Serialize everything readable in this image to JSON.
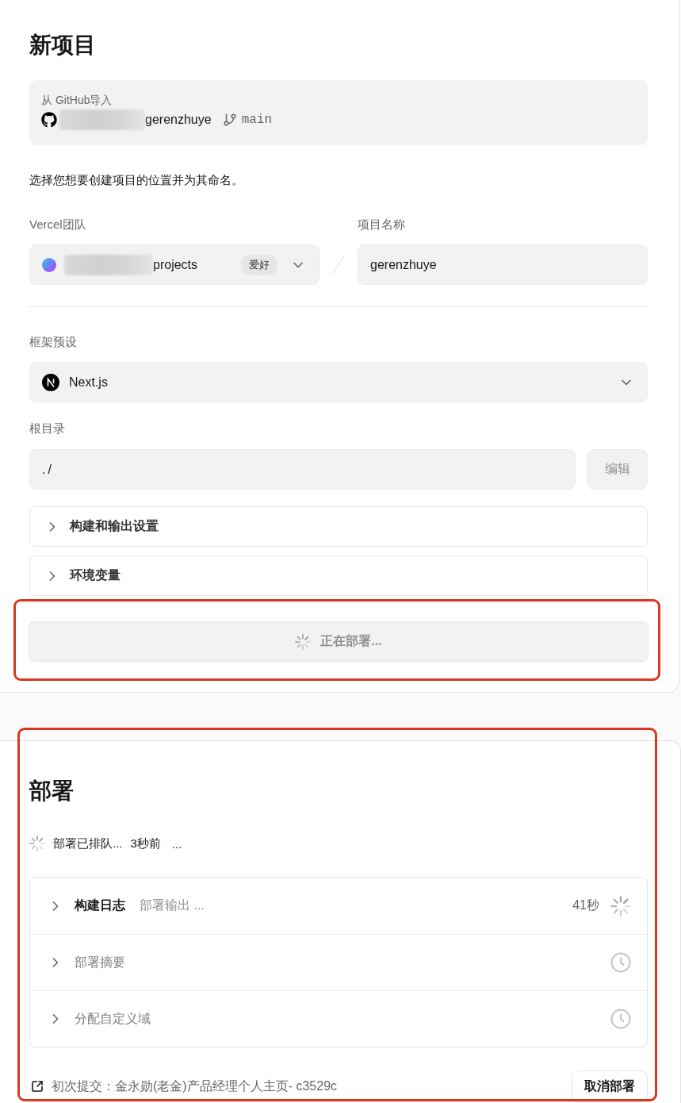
{
  "new_project": {
    "title": "新项目",
    "import_box": {
      "label": "从 GitHub导入",
      "repo": "gerenzhuye",
      "branch": "main"
    },
    "description": "选择您想要创建项目的位置并为其命名。",
    "team": {
      "label": "Vercel团队",
      "value": "projects",
      "badge": "爱好"
    },
    "project_name": {
      "label": "项目名称",
      "value": "gerenzhuye"
    },
    "framework": {
      "label": "框架预设",
      "value": "Next.js"
    },
    "root_directory": {
      "label": "根目录",
      "value": "./",
      "button": "编辑"
    },
    "sections": [
      {
        "label": "构建和输出设置",
        "expanded": false
      },
      {
        "label": "环境变量",
        "expanded": false
      }
    ],
    "deploy_button": {
      "label": "正在部署...",
      "loading": true,
      "disabled": true
    }
  },
  "deployment": {
    "title": "部署",
    "status": {
      "loading": true,
      "text": "部署已排队...",
      "time": "3秒前",
      "more": "..."
    },
    "steps": [
      {
        "kind": "running",
        "title": "构建日志",
        "detail": "部署输出 ...",
        "duration": "41秒",
        "expanded": false
      },
      {
        "kind": "pending",
        "title": "部署摘要",
        "expanded": false
      },
      {
        "kind": "pending",
        "title": "分配自定义域",
        "expanded": false
      }
    ],
    "commit": "初次提交：金永勋(老金)产品经理个人主页- c3529c",
    "cancel_button": "取消部署"
  }
}
